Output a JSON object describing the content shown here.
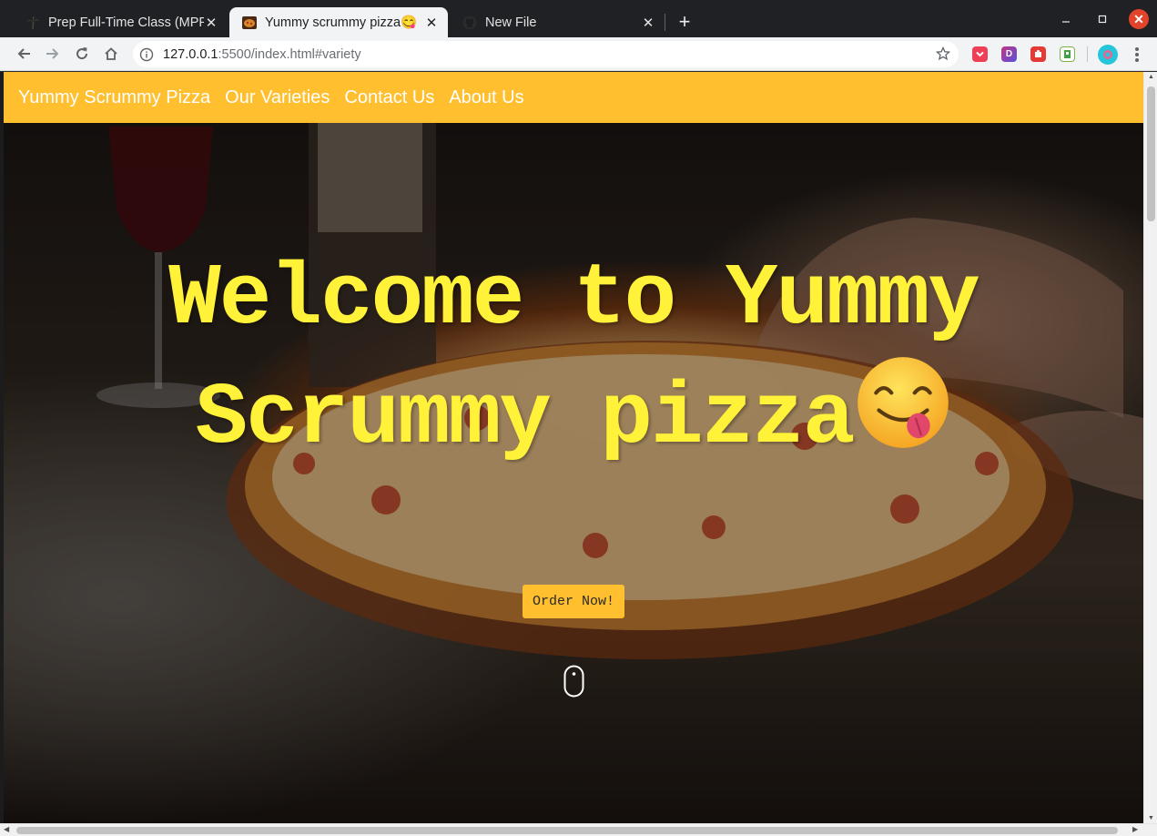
{
  "browser": {
    "tabs": [
      {
        "title": "Prep Full-Time Class (MPF",
        "favicon": "palm-tree-icon",
        "active": false
      },
      {
        "title": "Yummy scrummy pizza😋",
        "favicon": "pizza-image-icon",
        "active": true
      },
      {
        "title": "New File",
        "favicon": "github-icon",
        "active": false
      }
    ],
    "url_host": "127.0.0.1",
    "url_rest": ":5500/index.html#variety",
    "extensions": [
      "pocket-icon",
      "d-extension-icon",
      "puzzle-extension-icon",
      "evernote-icon",
      "profile-avatar-icon"
    ]
  },
  "nav": {
    "brand": "Yummy Scrummy Pizza",
    "links": [
      "Our Varieties",
      "Contact Us",
      "About Us"
    ]
  },
  "hero": {
    "headline": "Welcome to Yummy Scrummy pizza",
    "emoji": "face-savoring-food-emoji",
    "button": "Order Now!",
    "scroll_indicator": "mouse-scroll-icon"
  },
  "colors": {
    "navbar": "#ffbf2e",
    "headline": "#fff238",
    "button": "#ffbf2e"
  }
}
